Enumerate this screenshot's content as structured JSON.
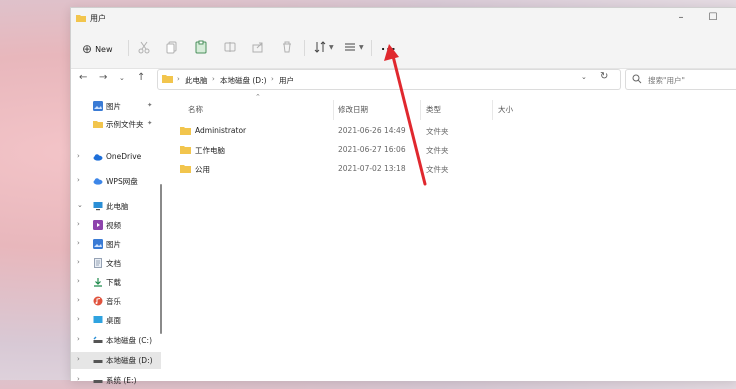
{
  "window": {
    "title": "用户"
  },
  "toolbar": {
    "new_label": "New",
    "more_label": "..."
  },
  "address": {
    "crumbs": [
      "此电脑",
      "本地磁盘 (D:)",
      "用户"
    ],
    "search_placeholder": "搜索\"用户\""
  },
  "nav": {
    "items": [
      {
        "label": "图片",
        "icon": "pictures-icon",
        "pinned": true
      },
      {
        "label": "示例文件夹",
        "icon": "folder-icon",
        "pinned": true
      },
      {
        "label": "OneDrive",
        "icon": "cloud-icon"
      },
      {
        "label": "WPS网盘",
        "icon": "cloud-icon"
      },
      {
        "label": "此电脑",
        "icon": "computer-icon"
      },
      {
        "label": "视频",
        "icon": "videos-icon"
      },
      {
        "label": "图片",
        "icon": "pictures-icon"
      },
      {
        "label": "文档",
        "icon": "documents-icon"
      },
      {
        "label": "下载",
        "icon": "downloads-icon"
      },
      {
        "label": "音乐",
        "icon": "music-icon"
      },
      {
        "label": "桌面",
        "icon": "desktop-icon"
      },
      {
        "label": "本地磁盘 (C:)",
        "icon": "drive-icon"
      },
      {
        "label": "本地磁盘 (D:)",
        "icon": "drive-icon",
        "selected": true
      },
      {
        "label": "系统 (E:)",
        "icon": "drive-icon"
      }
    ]
  },
  "list": {
    "columns": [
      "名称",
      "修改日期",
      "类型",
      "大小"
    ],
    "rows": [
      {
        "name": "Administrator",
        "date": "2021-06-26 14:49",
        "type": "文件夹"
      },
      {
        "name": "工作电脑",
        "date": "2021-06-27 16:06",
        "type": "文件夹"
      },
      {
        "name": "公用",
        "date": "2021-07-02 13:18",
        "type": "文件夹"
      }
    ]
  },
  "colors": {
    "accent_arrow": "#e0282e",
    "folder": "#f2c54d"
  }
}
